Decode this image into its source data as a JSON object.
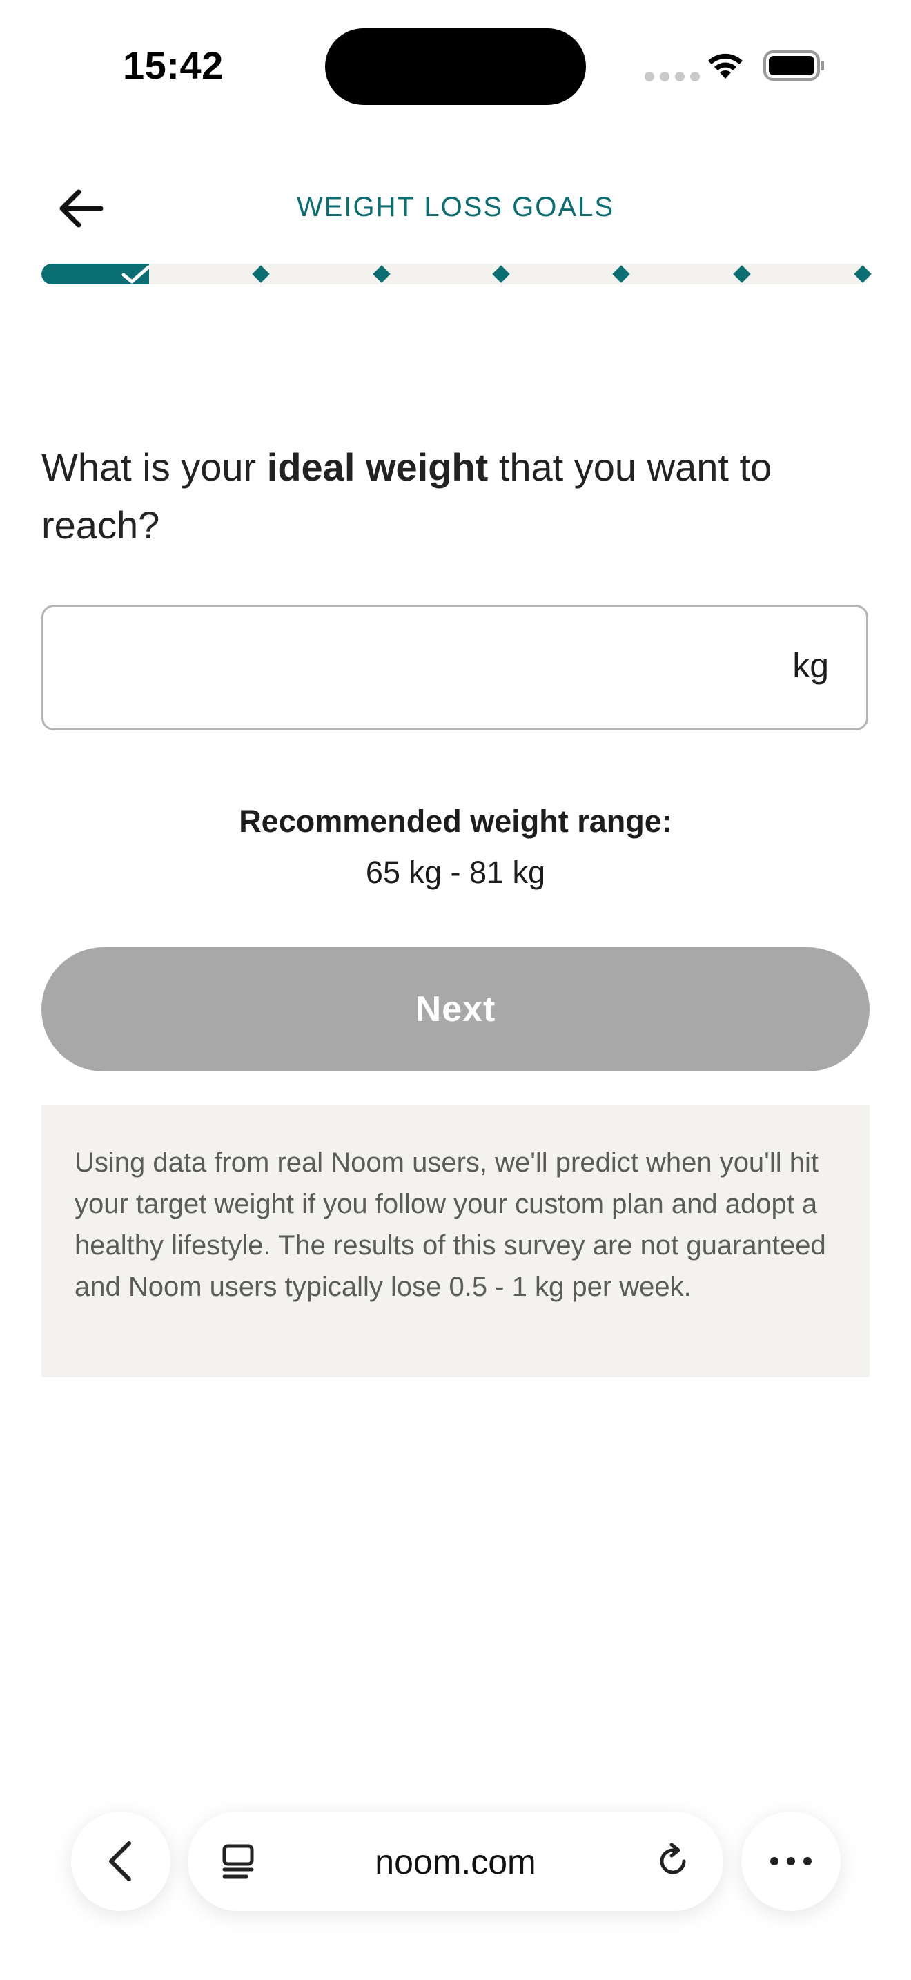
{
  "status_bar": {
    "time": "15:42"
  },
  "header": {
    "title": "WEIGHT LOSS GOALS"
  },
  "progress": {
    "completed_steps": 1,
    "total_steps": 7,
    "fraction": 0.13,
    "accent": "#0b6e72"
  },
  "question": {
    "prefix": "What is your ",
    "bold": "ideal weight",
    "suffix": " that you want to reach?"
  },
  "weight_input": {
    "value": "",
    "unit": "kg"
  },
  "recommended": {
    "label": "Recommended weight range:",
    "value": "65 kg - 81 kg"
  },
  "next_button": {
    "label": "Next",
    "enabled": false,
    "color": "#a8a8a8"
  },
  "disclaimer": {
    "text": "Using data from real Noom users, we'll predict when you'll hit your target weight if you follow your custom plan and adopt a healthy lifestyle. The results of this survey are not guaranteed and Noom users typically lose 0.5 - 1 kg per week."
  },
  "browser": {
    "url": "noom.com",
    "icons": [
      "chevron-left-icon",
      "tabs-icon",
      "reload-icon",
      "more-icon"
    ]
  }
}
